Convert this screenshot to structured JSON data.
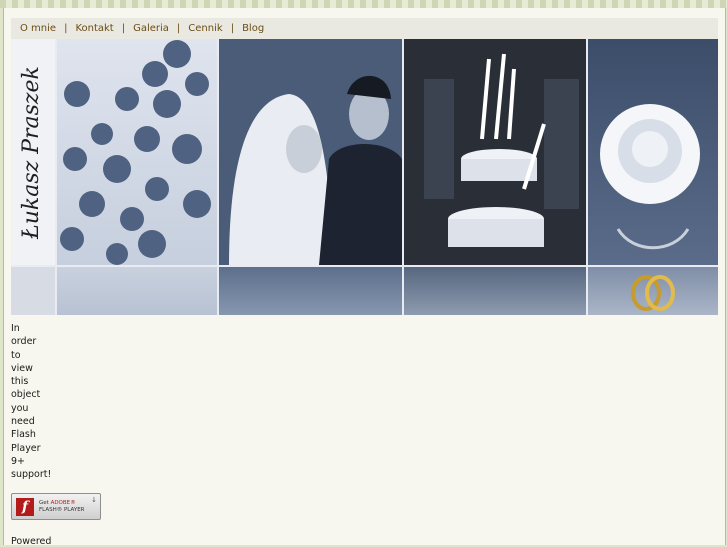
{
  "nav": {
    "items": [
      {
        "label": "O mnie"
      },
      {
        "label": "Kontakt"
      },
      {
        "label": "Galeria"
      },
      {
        "label": "Cennik"
      },
      {
        "label": "Blog"
      }
    ],
    "separator": "|"
  },
  "banner": {
    "signature": "Łukasz Praszek"
  },
  "flash_notice": {
    "lines": [
      "In",
      "order",
      "to",
      "view",
      "this",
      "object",
      "you",
      "need",
      "Flash",
      "Player",
      "9+",
      "support!"
    ]
  },
  "flash_button": {
    "logo": "f",
    "line1_prefix": "Get ",
    "line1_brand": "ADOBE®",
    "line2": "FLASH® PLAYER",
    "download_icon": "↓"
  },
  "footer": {
    "powered": "Powered"
  },
  "colors": {
    "nav_text": "#6b4e16",
    "background": "#f7f7ef",
    "border": "#b8c26a"
  }
}
